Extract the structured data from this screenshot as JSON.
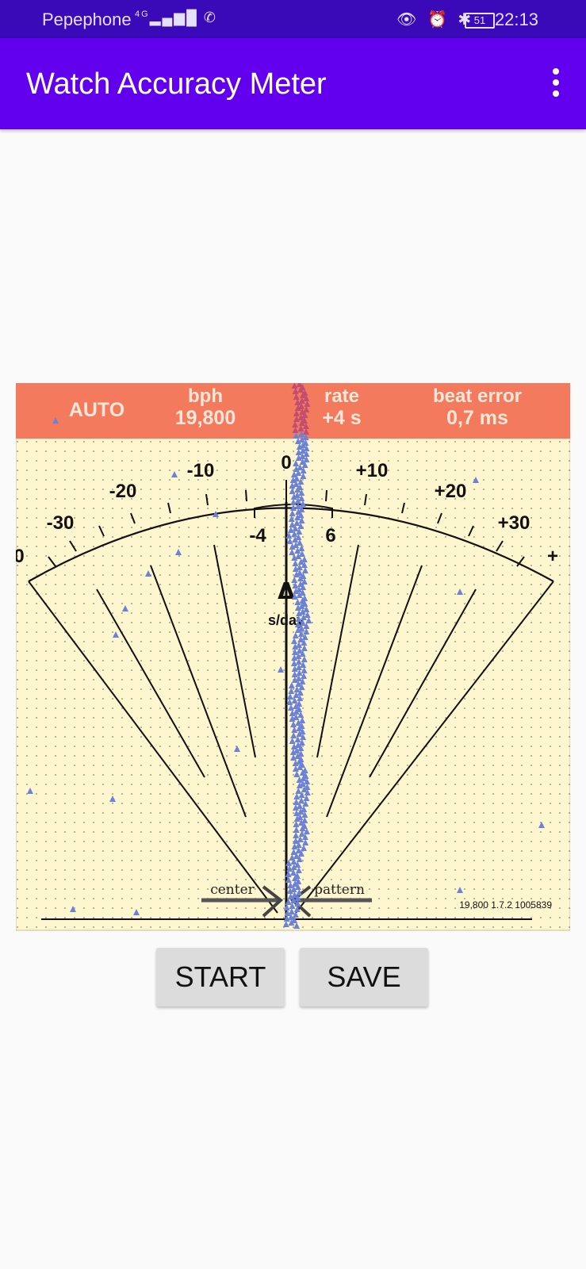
{
  "status_bar": {
    "carrier": "Pepephone",
    "network": "4G",
    "battery": "51",
    "time": "22:13"
  },
  "app_bar": {
    "title": "Watch Accuracy Meter",
    "menu_icon": "overflow-menu-icon"
  },
  "meter": {
    "header": {
      "mode": "AUTO",
      "bph_label": "bph",
      "bph_value": "19,800",
      "rate_label": "rate",
      "rate_value": "+4 s",
      "beat_error_label": "beat error",
      "beat_error_value": "0,7 ms"
    },
    "scale_labels": [
      "0",
      "-30",
      "-20",
      "-10",
      "0",
      "+10",
      "+20",
      "+30",
      "+"
    ],
    "inner_range": [
      "-4",
      "6"
    ],
    "delta_symbol": "Δ",
    "unit": "s/day",
    "center_label": "center",
    "pattern_label": "pattern",
    "footer_info": "19,800 1.7.2 1005839",
    "colors": {
      "header_bg": "#f47a5e",
      "header_text": "#fde7d8",
      "paper": "#fdf6cf",
      "trace": "#6b82d8",
      "trace_top": "#c34d6e"
    }
  },
  "buttons": {
    "start": "START",
    "save": "SAVE"
  }
}
